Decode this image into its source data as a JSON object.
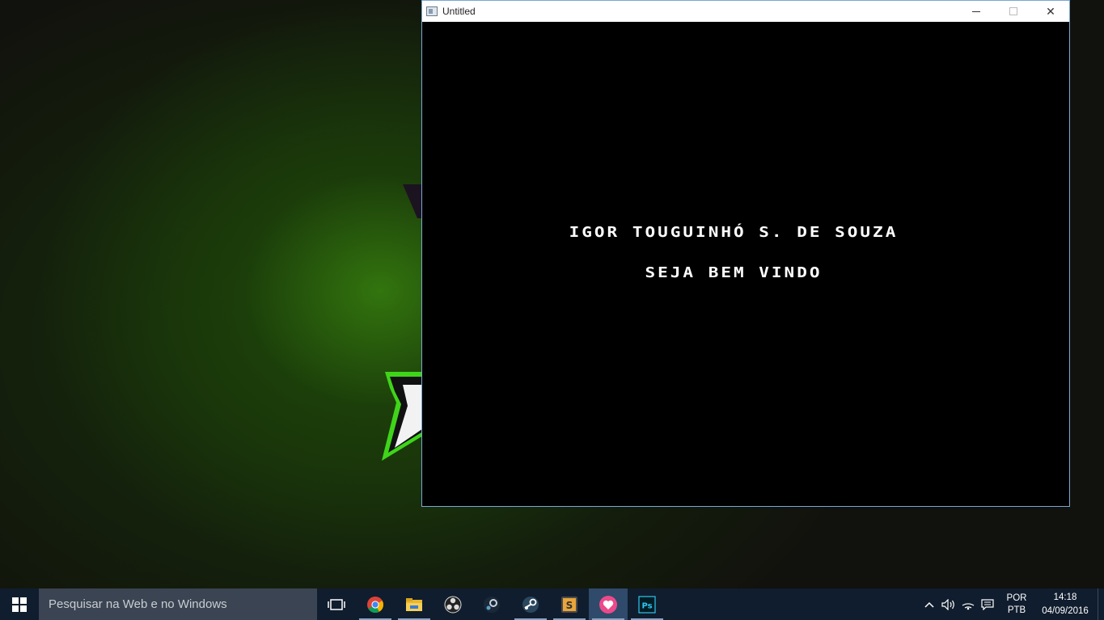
{
  "window": {
    "title": "Untitled",
    "close_glyph": "✕"
  },
  "canvas": {
    "line1": "IGOR TOUGUINHÓ S. DE SOUZA",
    "line2": "SEJA BEM VINDO"
  },
  "taskbar": {
    "search_placeholder": "Pesquisar na Web e no Windows",
    "apps": [
      {
        "name": "chrome-icon",
        "running": true
      },
      {
        "name": "file-explorer-icon",
        "running": true
      },
      {
        "name": "obs-icon",
        "running": false
      },
      {
        "name": "steam-client-icon",
        "running": false
      },
      {
        "name": "steam-icon",
        "running": true
      },
      {
        "name": "sublime-icon",
        "running": true
      },
      {
        "name": "heart-app-icon",
        "running": true,
        "active": true
      },
      {
        "name": "photoshop-icon",
        "running": true
      }
    ],
    "photoshop_label": "Ps",
    "sublime_label": "S"
  },
  "tray": {
    "lang_primary": "POR",
    "lang_secondary": "PTB",
    "time": "14:18",
    "date": "04/09/2016"
  },
  "colors": {
    "taskbar": "#101d2e",
    "search": "#3a4452",
    "window_border": "#7aa7d6",
    "logo_green": "#3fd41a"
  }
}
